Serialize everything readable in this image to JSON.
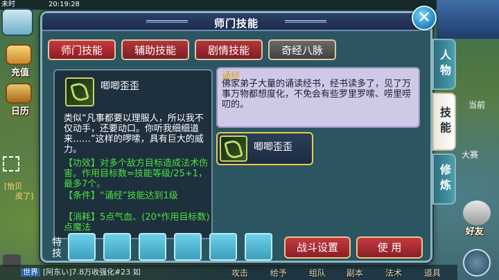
{
  "hud": {
    "carrier": "未时",
    "clock": "20:19:28",
    "left_items": [
      {
        "label": "充值"
      },
      {
        "label": "日历"
      }
    ],
    "chat_snippet_1": "[怡贝",
    "chat_snippet_2": "皮了]",
    "right_snippet_1": "当前",
    "right_snippet_2": "大赛",
    "friends_label": "好友",
    "chat_channel": "世界",
    "chat_message": "[阿东い]7.8万收强化#23 如",
    "bottom_menu": [
      "攻击",
      "给予",
      "组队",
      "副本",
      "法术",
      "道具"
    ]
  },
  "dialog": {
    "title": "师门技能",
    "tabs": [
      {
        "label": "师门技能",
        "state": "active"
      },
      {
        "label": "辅助技能",
        "state": "normal"
      },
      {
        "label": "剧情技能",
        "state": "normal"
      },
      {
        "label": "奇经八脉",
        "state": "gray"
      }
    ],
    "side_tabs": [
      {
        "label": "人物",
        "active": false
      },
      {
        "label": "技能",
        "active": true
      },
      {
        "label": "修炼",
        "active": false
      }
    ],
    "tooltip": {
      "name": "唧唧歪歪",
      "desc": "类似“凡事都要以理服人，所以我不仅动手，还要动口。你听我细细道来……”这样的啰嗦，具有巨大的威力。",
      "effect": "【功效】对多个敌方目标造成法术伤害。作用目标数=技能等级/25+1，最多7个。",
      "condition": "【条件】“诵经”技能达到1级",
      "cost": "【消耗】5点气血、(20*作用目标数)点魔法"
    },
    "description": {
      "title": "诵经",
      "text": "佛家弟子大量的诵读经书，经书读多了，见了万事万物都想度化，不免会有些罗里罗嗦、唠里唠叨的。"
    },
    "skill_card": {
      "name": "唧唧歪歪"
    },
    "special_label": "特技",
    "slot_count": 6,
    "buttons": {
      "battle_settings": "战斗设置",
      "use": "使 用"
    },
    "colors": {
      "accent_red": "#c8383d",
      "effect_green": "#49e23f",
      "desc_title_gold": "#d7a31a"
    }
  }
}
